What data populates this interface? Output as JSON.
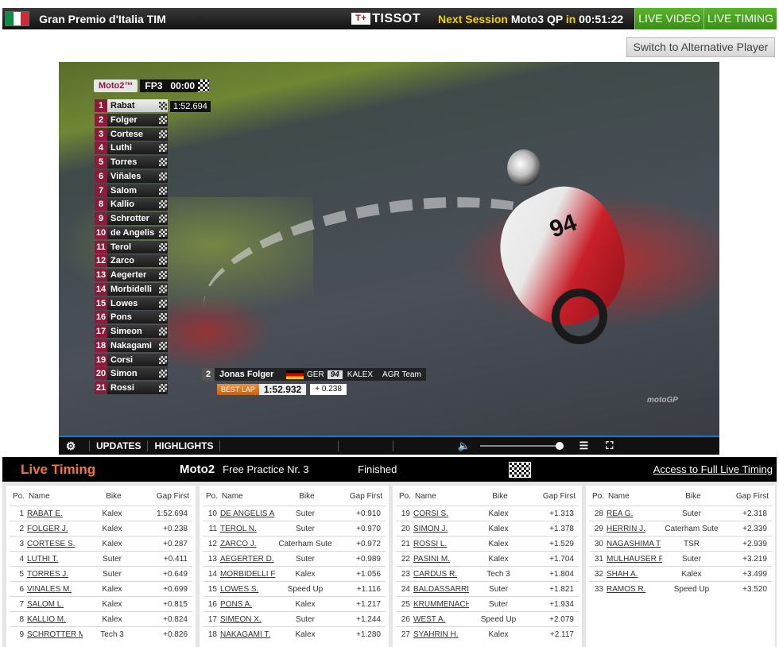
{
  "header": {
    "flag_colors": [
      "#009246",
      "#ffffff",
      "#ce2b37"
    ],
    "event_title": "Gran Premio d'Italia TIM",
    "sponsor_mark": "T+",
    "sponsor": "TISSOT",
    "next_label": "Next Session",
    "next_session": "Moto3 QP",
    "next_in": "in",
    "countdown": "00:51:22",
    "live_video": "LIVE VIDEO",
    "live_timing": "LIVE TIMING"
  },
  "alt_player_label": "Switch to Alternative Player",
  "video": {
    "overlay_class": "Moto2™",
    "overlay_session": "FP3",
    "overlay_clock": "00:00",
    "leader_time": "1:52.694",
    "standings": [
      {
        "pos": "1",
        "name": "Rabat"
      },
      {
        "pos": "2",
        "name": "Folger"
      },
      {
        "pos": "3",
        "name": "Cortese"
      },
      {
        "pos": "4",
        "name": "Luthi"
      },
      {
        "pos": "5",
        "name": "Torres"
      },
      {
        "pos": "6",
        "name": "Viñales"
      },
      {
        "pos": "7",
        "name": "Salom"
      },
      {
        "pos": "8",
        "name": "Kallio"
      },
      {
        "pos": "9",
        "name": "Schrotter"
      },
      {
        "pos": "10",
        "name": "de Angelis"
      },
      {
        "pos": "11",
        "name": "Terol"
      },
      {
        "pos": "12",
        "name": "Zarco"
      },
      {
        "pos": "13",
        "name": "Aegerter"
      },
      {
        "pos": "14",
        "name": "Morbidelli"
      },
      {
        "pos": "15",
        "name": "Lowes"
      },
      {
        "pos": "16",
        "name": "Pons"
      },
      {
        "pos": "17",
        "name": "Simeon"
      },
      {
        "pos": "18",
        "name": "Nakagami"
      },
      {
        "pos": "19",
        "name": "Corsi"
      },
      {
        "pos": "20",
        "name": "Simon"
      },
      {
        "pos": "21",
        "name": "Rossi"
      }
    ],
    "rider_card": {
      "pos": "2",
      "name": "Jonas Folger",
      "country": "GER",
      "number": "94",
      "bike": "KALEX",
      "team": "AGR Team",
      "best_lap_label": "BEST LAP",
      "best_lap": "1:52.932",
      "gap": "+ 0.238"
    },
    "fairing_number": "94",
    "watermark": "motoGP"
  },
  "controls": {
    "updates": "UPDATES",
    "highlights": "HIGHLIGHTS",
    "volume_level": 1.0
  },
  "timing": {
    "title": "Live Timing",
    "class": "Moto2",
    "session": "Free Practice Nr. 3",
    "status": "Finished",
    "full_link": "Access to Full Live Timing",
    "headers": {
      "pos": "Po.",
      "name": "Name",
      "bike": "Bike",
      "gap": "Gap First"
    },
    "columns": [
      [
        {
          "pos": "1",
          "name": "RABAT E.",
          "bike": "Kalex",
          "gap": "1:52.694"
        },
        {
          "pos": "2",
          "name": "FOLGER J.",
          "bike": "Kalex",
          "gap": "+0.238"
        },
        {
          "pos": "3",
          "name": "CORTESE S.",
          "bike": "Kalex",
          "gap": "+0.287"
        },
        {
          "pos": "4",
          "name": "LUTHI T.",
          "bike": "Suter",
          "gap": "+0.411"
        },
        {
          "pos": "5",
          "name": "TORRES J.",
          "bike": "Suter",
          "gap": "+0.649"
        },
        {
          "pos": "6",
          "name": "VIÑALES M.",
          "bike": "Kalex",
          "gap": "+0.699"
        },
        {
          "pos": "7",
          "name": "SALOM L.",
          "bike": "Kalex",
          "gap": "+0.815"
        },
        {
          "pos": "8",
          "name": "KALLIO M.",
          "bike": "Kalex",
          "gap": "+0.824"
        },
        {
          "pos": "9",
          "name": "SCHROTTER M",
          "bike": "Tech 3",
          "gap": "+0.826"
        }
      ],
      [
        {
          "pos": "10",
          "name": "DE ANGELIS A",
          "bike": "Suter",
          "gap": "+0.910"
        },
        {
          "pos": "11",
          "name": "TEROL N.",
          "bike": "Suter",
          "gap": "+0.970"
        },
        {
          "pos": "12",
          "name": "ZARCO J.",
          "bike": "Caterham Sute",
          "gap": "+0.972"
        },
        {
          "pos": "13",
          "name": "AEGERTER D.",
          "bike": "Suter",
          "gap": "+0.989"
        },
        {
          "pos": "14",
          "name": "MORBIDELLI F",
          "bike": "Kalex",
          "gap": "+1.056"
        },
        {
          "pos": "15",
          "name": "LOWES S.",
          "bike": "Speed Up",
          "gap": "+1.116"
        },
        {
          "pos": "16",
          "name": "PONS A.",
          "bike": "Kalex",
          "gap": "+1.217"
        },
        {
          "pos": "17",
          "name": "SIMEON X.",
          "bike": "Suter",
          "gap": "+1.244"
        },
        {
          "pos": "18",
          "name": "NAKAGAMI T.",
          "bike": "Kalex",
          "gap": "+1.280"
        }
      ],
      [
        {
          "pos": "19",
          "name": "CORSI S.",
          "bike": "Kalex",
          "gap": "+1.313"
        },
        {
          "pos": "20",
          "name": "SIMON J.",
          "bike": "Kalex",
          "gap": "+1.378"
        },
        {
          "pos": "21",
          "name": "ROSSI L.",
          "bike": "Kalex",
          "gap": "+1.529"
        },
        {
          "pos": "22",
          "name": "PASINI M.",
          "bike": "Kalex",
          "gap": "+1.704"
        },
        {
          "pos": "23",
          "name": "CARDUS R.",
          "bike": "Tech 3",
          "gap": "+1.804"
        },
        {
          "pos": "24",
          "name": "BALDASSARRI",
          "bike": "Suter",
          "gap": "+1.821"
        },
        {
          "pos": "25",
          "name": "KRUMMENACH",
          "bike": "Suter",
          "gap": "+1.934"
        },
        {
          "pos": "26",
          "name": "WEST A.",
          "bike": "Speed Up",
          "gap": "+2.079"
        },
        {
          "pos": "27",
          "name": "SYAHRIN H.",
          "bike": "Kalex",
          "gap": "+2.117"
        }
      ],
      [
        {
          "pos": "28",
          "name": "REA G.",
          "bike": "Suter",
          "gap": "+2.318"
        },
        {
          "pos": "29",
          "name": "HERRIN J.",
          "bike": "Caterham Sute",
          "gap": "+2.339"
        },
        {
          "pos": "30",
          "name": "NAGASHIMA T",
          "bike": "TSR",
          "gap": "+2.939"
        },
        {
          "pos": "31",
          "name": "MULHAUSER F",
          "bike": "Suter",
          "gap": "+3.219"
        },
        {
          "pos": "32",
          "name": "SHAH A.",
          "bike": "Kalex",
          "gap": "+3.499"
        },
        {
          "pos": "33",
          "name": "RAMOS R.",
          "bike": "Speed Up",
          "gap": "+3.520"
        }
      ]
    ]
  }
}
